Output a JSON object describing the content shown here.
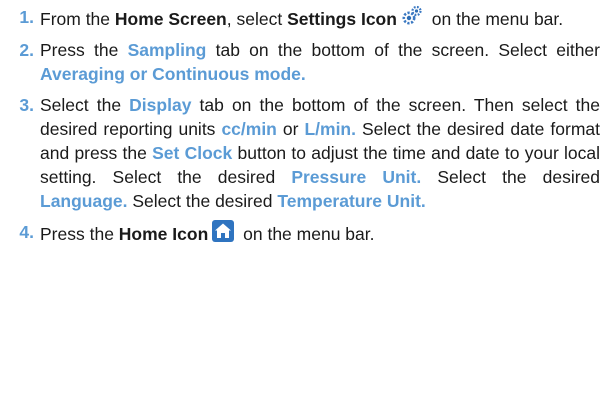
{
  "colors": {
    "accent": "#5b9bd5",
    "text": "#1a1a1a"
  },
  "steps": [
    {
      "number": "1.",
      "t1": "From the ",
      "home_screen": "Home Screen",
      "t2": ", select ",
      "settings_icon": "Settings Icon",
      "icon": "gear-icon",
      "t3": " on the menu bar."
    },
    {
      "number": "2.",
      "t1": "Press the ",
      "sampling": "Sampling",
      "t2": " tab on the bottom of the screen. Select either ",
      "modes": "Averaging or Continuous mode."
    },
    {
      "number": "3.",
      "t1": "Select the ",
      "display": "Display",
      "t2": " tab on the bottom of the screen. Then select the desired reporting units ",
      "unit1": "cc/min",
      "t3": " or ",
      "unit2": "L/min.",
      "t4": " Select the desired date format and press the ",
      "set_clock": "Set Clock",
      "t5": " button to adjust the time and date to your local setting. Select the desired ",
      "pressure_unit": "Pressure Unit.",
      "t6": " Select the desired ",
      "language": "Language.",
      "t7": " Select the desired ",
      "temperature_unit": "Temperature Unit."
    },
    {
      "number": "4.",
      "t1": "Press the ",
      "home_icon": "Home Icon",
      "icon": "home-icon",
      "t2": " on the menu bar."
    }
  ]
}
